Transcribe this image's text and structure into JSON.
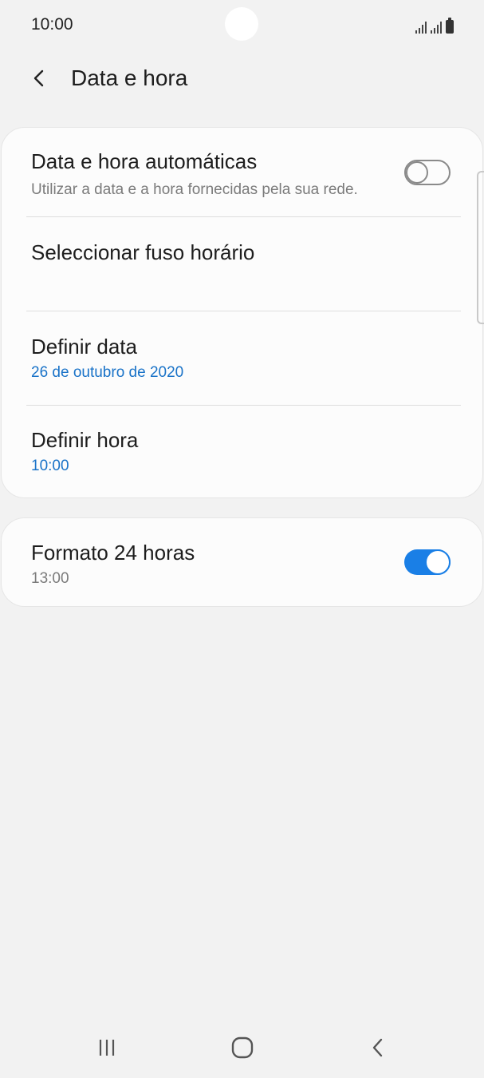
{
  "status_bar": {
    "time": "10:00"
  },
  "header": {
    "title": "Data e hora",
    "back_icon": "chevron-left-icon"
  },
  "settings": {
    "auto_datetime": {
      "title": "Data e hora automáticas",
      "subtitle": "Utilizar a data e a hora fornecidas pela sua rede.",
      "enabled": false
    },
    "timezone": {
      "title": "Seleccionar fuso horário"
    },
    "set_date": {
      "title": "Definir data",
      "value": "26 de outubro de 2020"
    },
    "set_time": {
      "title": "Definir hora",
      "value": "10:00"
    },
    "format_24h": {
      "title": "Formato 24 horas",
      "subtitle": "13:00",
      "enabled": true
    }
  },
  "nav_bar": {
    "recents_icon": "recents-icon",
    "home_icon": "home-icon",
    "back_icon": "back-icon"
  },
  "colors": {
    "accent": "#1a7fe6",
    "link": "#1a73c8",
    "background": "#f2f2f2",
    "card": "#fcfcfc"
  }
}
